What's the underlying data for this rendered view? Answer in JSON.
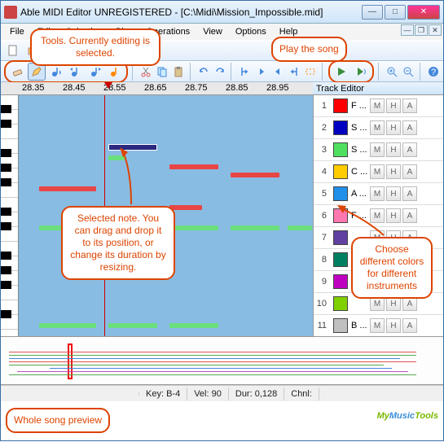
{
  "window": {
    "title": "Able MIDI Editor UNREGISTERED - [C:\\Midi\\Mission_Impossible.mid]"
  },
  "menu": {
    "items": [
      "File",
      "Edit",
      "Selection",
      "Play",
      "Operations",
      "View",
      "Options",
      "Help"
    ]
  },
  "ruler": {
    "ticks": [
      "28.35",
      "28.45",
      "28.55",
      "28.65",
      "28.75",
      "28.85",
      "28.95"
    ]
  },
  "track_editor": {
    "title": "Track Editor",
    "btn_labels": [
      "M",
      "H",
      "A"
    ],
    "rows": [
      {
        "num": "1",
        "color": "#ff0000",
        "name": "F ..."
      },
      {
        "num": "2",
        "color": "#0000c0",
        "name": "S ..."
      },
      {
        "num": "3",
        "color": "#50e060",
        "name": "S ..."
      },
      {
        "num": "4",
        "color": "#ffcc00",
        "name": "C ..."
      },
      {
        "num": "5",
        "color": "#2090e8",
        "name": "A ..."
      },
      {
        "num": "6",
        "color": "#ff77b0",
        "name": "F ..."
      },
      {
        "num": "7",
        "color": "#6040a0",
        "name": ""
      },
      {
        "num": "8",
        "color": "#008060",
        "name": ""
      },
      {
        "num": "9",
        "color": "#c000c0",
        "name": ""
      },
      {
        "num": "10",
        "color": "#80d000",
        "name": ""
      },
      {
        "num": "11",
        "color": "#c0c0c0",
        "name": "B ..."
      }
    ]
  },
  "status": {
    "key_label": "Key:",
    "key_val": "B-4",
    "vel_label": "Vel:",
    "vel_val": "90",
    "dur_label": "Dur:",
    "dur_val": "0,128",
    "chnl_label": "Chnl:"
  },
  "callouts": {
    "tools": "Tools. Currently editing is selected.",
    "play": "Play the song",
    "note": "Selected note. You can drag and drop it to its position, or change its duration by resizing.",
    "colors": "Choose different colors for different instruments",
    "preview": "Whole song preview"
  },
  "logo": {
    "t1": "My",
    "t2": "Music",
    "t3": "Tools"
  }
}
